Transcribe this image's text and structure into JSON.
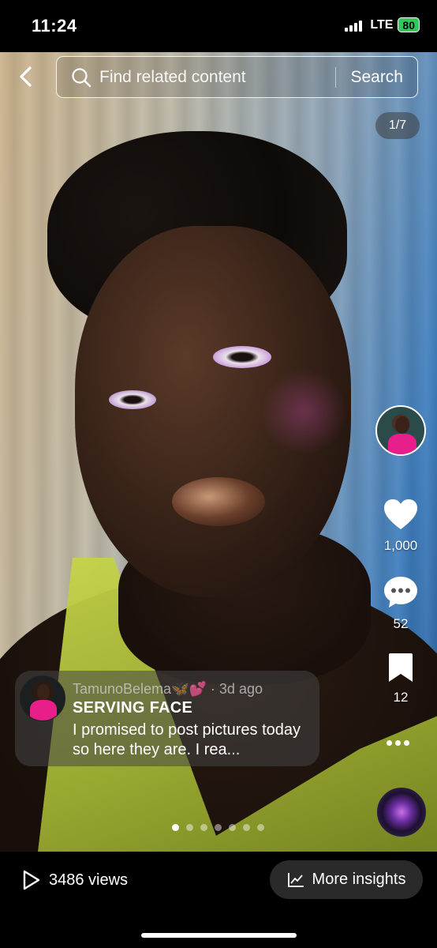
{
  "status_bar": {
    "time": "11:24",
    "network": "LTE",
    "battery": "80"
  },
  "search": {
    "placeholder": "Find related content",
    "button_label": "Search"
  },
  "photo": {
    "counter": "1/7",
    "current_index": 1,
    "total": 7
  },
  "rail": {
    "likes": "1,000",
    "comments": "52",
    "bookmarks": "12"
  },
  "caption": {
    "username": "TamunoBelema🦋💕",
    "time_ago": "· 3d ago",
    "title": "SERVING FACE",
    "body": "I promised to post pictures today so here they are.  I rea..."
  },
  "bottom": {
    "views": "3486 views",
    "insights_label": "More insights"
  },
  "icons": [
    "back-arrow-icon",
    "search-icon",
    "heart-icon",
    "comment-icon",
    "bookmark-icon",
    "more-icon",
    "play-icon",
    "chart-icon"
  ],
  "colors": {
    "accent_pink": "#e81e8a",
    "battery_green": "#34c759",
    "top_lime": "#c7d64a"
  }
}
